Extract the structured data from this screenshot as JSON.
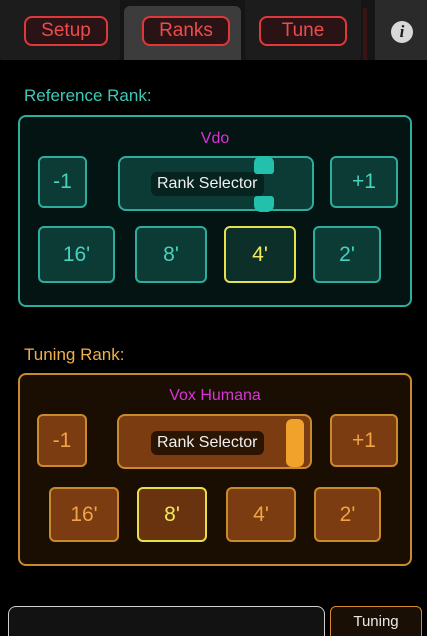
{
  "tabs": {
    "setup": "Setup",
    "ranks": "Ranks",
    "tune": "Tune",
    "info_icon": "i"
  },
  "reference": {
    "heading": "Reference Rank:",
    "rank_name": "Vdo",
    "minus_label": "-1",
    "plus_label": "+1",
    "selector_label": "Rank Selector",
    "footages": [
      "16'",
      "8'",
      "4'",
      "2'"
    ],
    "selected_footage": "4'"
  },
  "tuning": {
    "heading": "Tuning Rank:",
    "rank_name": "Vox Humana",
    "minus_label": "-1",
    "plus_label": "+1",
    "selector_label": "Rank Selector",
    "footages": [
      "16'",
      "8'",
      "4'",
      "2'"
    ],
    "selected_footage": "8'"
  },
  "bottom": {
    "field_value": "",
    "tuning_tab": "Tuning"
  },
  "colors": {
    "reference_accent": "#2cae9e",
    "tuning_accent": "#c98a2c",
    "selected_accent": "#e6e04a",
    "tab_red": "#e0383a",
    "rank_name": "#d833d8"
  }
}
